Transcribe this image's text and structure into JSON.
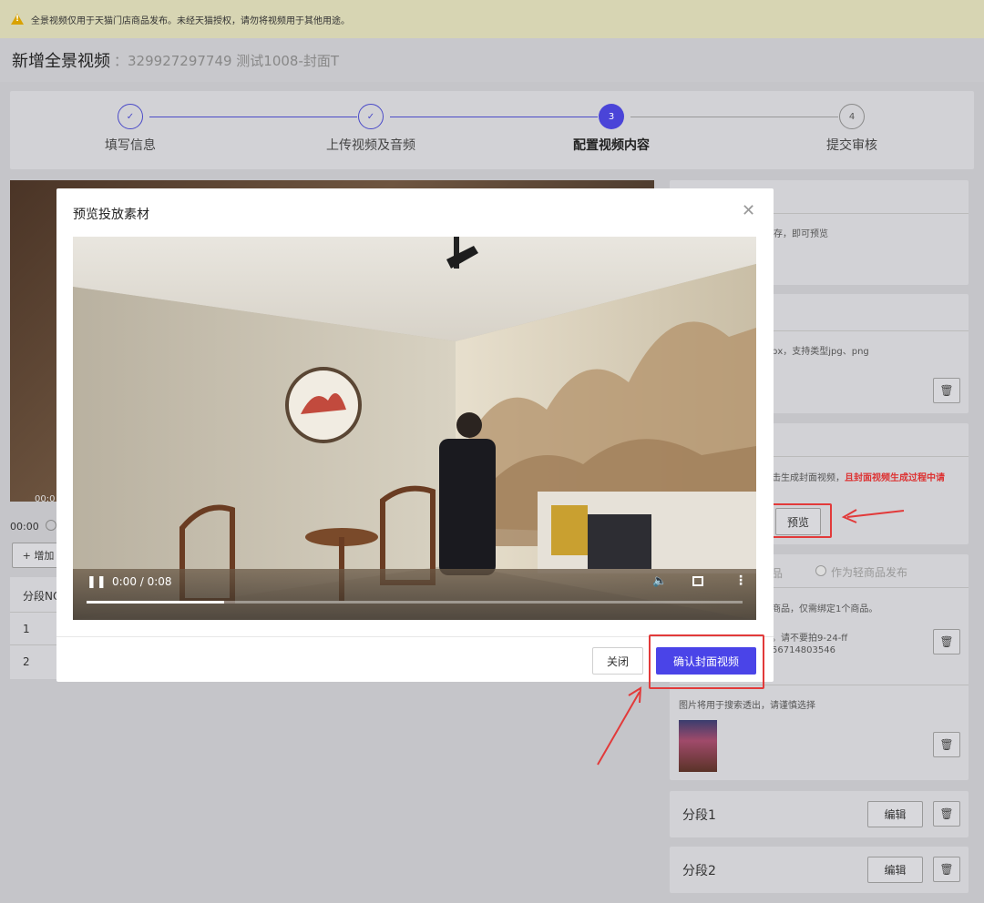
{
  "banner": {
    "text": "全景视频仅用于天猫门店商品发布。未经天猫授权，请勿将视频用于其他用途。"
  },
  "header": {
    "title": "新增全景视频",
    "separator": "：",
    "subtitle": "329927297749  测试1008-封面T"
  },
  "steps": [
    {
      "num": "✓",
      "label": "填写信息",
      "state": "done"
    },
    {
      "num": "✓",
      "label": "上传视频及音频",
      "state": "done"
    },
    {
      "num": "3",
      "label": "配置视频内容",
      "state": "active"
    },
    {
      "num": "4",
      "label": "提交审核",
      "state": "todo"
    }
  ],
  "left": {
    "video_time": "00:0",
    "time_label": "00:00",
    "add_button": "+ 增加",
    "table_header": "分段NO",
    "rows": [
      "1",
      "2"
    ]
  },
  "right": {
    "panel1_text": "存，即可预览",
    "panel2_text": "px，支持类型jpg、png",
    "panel3_text": "击生成封面视频，",
    "panel3_red": "且封面视频生成过程中请",
    "preview_button": "预览",
    "radio_label": "作为轻商品发布",
    "radio_left": "品",
    "panel4_text1": "商品，仅需绑定1个商品。",
    "panel4_text2": "。请不要拍9-24-ff",
    "panel4_text3": "56714803546",
    "panel5_text": "图片将用于搜索透出，请谨慎选择",
    "segment1": "分段1",
    "segment2": "分段2",
    "edit_label": "编辑"
  },
  "modal": {
    "title": "预览投放素材",
    "time": "0:00 / 0:08",
    "progress": 0.21,
    "close_button": "关闭",
    "confirm_button": "确认封面视频"
  },
  "icons": {
    "trash": "trash-icon",
    "close": "close-icon",
    "pause": "pause-icon",
    "volume": "volume-icon",
    "fullscreen": "fullscreen-icon",
    "more": "more-icon"
  },
  "colors": {
    "accent": "#4a44e8",
    "annotation": "#e23a3a"
  }
}
